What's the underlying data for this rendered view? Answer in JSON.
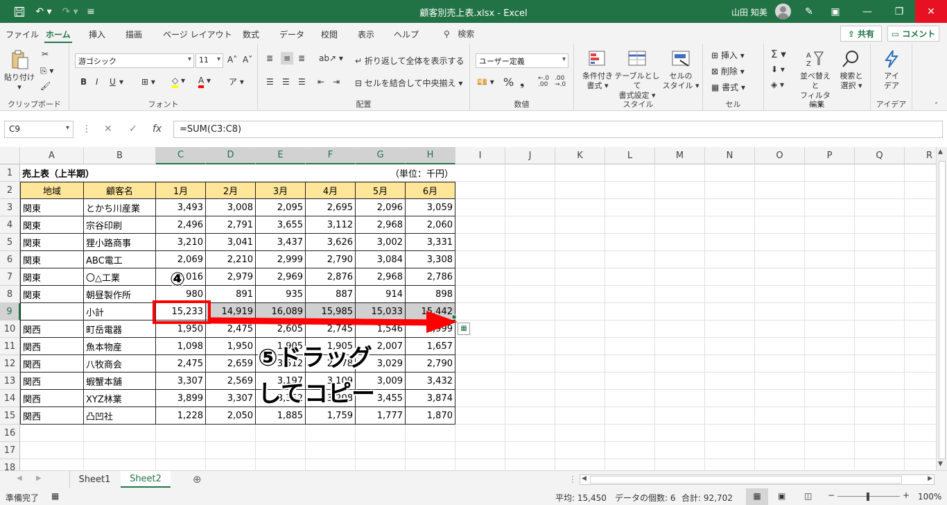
{
  "titlebar": {
    "title": "顧客別売上表.xlsx  -  Excel",
    "user": "山田 知美",
    "save_icon": "save-icon",
    "undo_icon": "undo-icon",
    "redo_icon": "redo-icon"
  },
  "menu": {
    "tabs": [
      "ファイル",
      "ホーム",
      "挿入",
      "描画",
      "ページ レイアウト",
      "数式",
      "データ",
      "校閲",
      "表示",
      "ヘルプ"
    ],
    "active": "ホーム",
    "search": "検索",
    "share": "共有",
    "comment": "コメント"
  },
  "ribbon": {
    "clipboard": {
      "label": "クリップボード",
      "paste": "貼り付け"
    },
    "font": {
      "label": "フォント",
      "name": "游ゴシック",
      "size": "11",
      "bold": "B",
      "italic": "I",
      "underline": "U"
    },
    "alignment": {
      "label": "配置",
      "wrap": "折り返して全体を表示する",
      "merge": "セルを結合して中央揃え"
    },
    "number": {
      "label": "数値",
      "format": "ユーザー定義"
    },
    "styles": {
      "label": "スタイル",
      "conditional": [
        "条件付き",
        "書式"
      ],
      "table": [
        "テーブルとして",
        "書式設定"
      ],
      "cell": [
        "セルの",
        "スタイル"
      ]
    },
    "cells": {
      "label": "セル",
      "insert": "挿入",
      "delete": "削除",
      "format": "書式"
    },
    "editing": {
      "label": "編集",
      "sort": [
        "並べ替えと",
        "フィルター"
      ],
      "find": [
        "検索と",
        "選択"
      ]
    },
    "ideas": {
      "label": "アイデア",
      "btn": [
        "アイ",
        "デア"
      ]
    }
  },
  "formula_bar": {
    "name_box": "C9",
    "formula": "=SUM(C3:C8)",
    "fx": "fx"
  },
  "columns": [
    "A",
    "B",
    "C",
    "D",
    "E",
    "F",
    "G",
    "H",
    "I",
    "J",
    "K",
    "L",
    "M",
    "N",
    "O",
    "P",
    "Q",
    "R"
  ],
  "rows": [
    "1",
    "2",
    "3",
    "4",
    "5",
    "6",
    "7",
    "8",
    "9",
    "10",
    "11",
    "12",
    "13",
    "14",
    "15",
    "16",
    "17",
    "18"
  ],
  "sheet": {
    "title": "売上表（上半期）",
    "unit": "（単位：千円）",
    "headers": [
      "地域",
      "顧客名",
      "1月",
      "2月",
      "3月",
      "4月",
      "5月",
      "6月"
    ],
    "data": [
      [
        "関東",
        "とかち川産業",
        "3,493",
        "3,008",
        "2,095",
        "2,695",
        "2,096",
        "3,059"
      ],
      [
        "関東",
        "宗谷印刷",
        "2,496",
        "2,791",
        "3,655",
        "3,112",
        "2,968",
        "2,060"
      ],
      [
        "関東",
        "狸小路商事",
        "3,210",
        "3,041",
        "3,437",
        "3,626",
        "3,002",
        "3,331"
      ],
      [
        "関東",
        "ABC電工",
        "2,069",
        "2,210",
        "2,999",
        "2,790",
        "3,084",
        "3,308"
      ],
      [
        "関東",
        "〇△工業",
        "3,016",
        "2,979",
        "2,969",
        "2,876",
        "2,968",
        "2,786"
      ],
      [
        "関東",
        "朝昼製作所",
        "980",
        "891",
        "935",
        "887",
        "914",
        "898"
      ],
      [
        "",
        "小計",
        "15,233",
        "14,919",
        "16,089",
        "15,985",
        "15,033",
        "15,442"
      ],
      [
        "関西",
        "町岳電器",
        "1,950",
        "2,475",
        "2,605",
        "2,745",
        "1,546",
        "1,999"
      ],
      [
        "関西",
        "魚本物産",
        "1,098",
        "1,950",
        "1,905",
        "1,905",
        "2,007",
        "1,657"
      ],
      [
        "関西",
        "八牧商会",
        "2,475",
        "2,659",
        "3,512",
        "2,678",
        "3,029",
        "2,790"
      ],
      [
        "関西",
        "蝦蟹本舗",
        "3,307",
        "2,569",
        "3,197",
        "3,109",
        "3,009",
        "3,432"
      ],
      [
        "関西",
        "XYZ林業",
        "3,899",
        "3,307",
        "3,352",
        "3,208",
        "3,455",
        "3,874"
      ],
      [
        "関西",
        "凸凹社",
        "1,228",
        "2,050",
        "1,885",
        "1,759",
        "1,777",
        "1,870"
      ]
    ]
  },
  "annotations": {
    "step4": "④",
    "step5_line1": "⑤ドラッグ",
    "step5_line2": "してコピー"
  },
  "sheets": [
    "Sheet1",
    "Sheet2"
  ],
  "active_sheet": "Sheet2",
  "status": {
    "ready": "準備完了",
    "average": "平均: 15,450",
    "count": "データの個数: 6",
    "sum": "合計: 92,702",
    "zoom": "100%"
  },
  "colors": {
    "accent": "#217346",
    "header_fill": "#ffe699",
    "annotation": "#ff0000"
  }
}
